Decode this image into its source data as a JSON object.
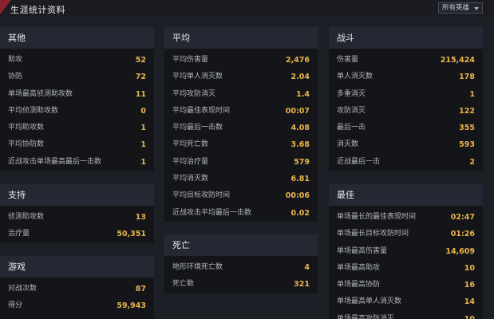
{
  "header": {
    "title": "生涯统计资料",
    "hero_filter": "所有英雄"
  },
  "panels": {
    "other": {
      "title": "其他",
      "rows": [
        {
          "label": "助攻",
          "value": "52"
        },
        {
          "label": "协防",
          "value": "72"
        },
        {
          "label": "单场最高侦测助攻数",
          "value": "11"
        },
        {
          "label": "平均侦测助攻数",
          "value": "0"
        },
        {
          "label": "平均助攻数",
          "value": "1"
        },
        {
          "label": "平均协防数",
          "value": "1"
        },
        {
          "label": "近战攻击单场最高最后一击数",
          "value": "1"
        }
      ]
    },
    "support": {
      "title": "支持",
      "rows": [
        {
          "label": "侦测助攻数",
          "value": "13"
        },
        {
          "label": "治疗量",
          "value": "50,351"
        }
      ]
    },
    "game": {
      "title": "游戏",
      "rows": [
        {
          "label": "对战次数",
          "value": "87"
        },
        {
          "label": "得分",
          "value": "59,943"
        }
      ]
    },
    "average": {
      "title": "平均",
      "rows": [
        {
          "label": "平均伤害量",
          "value": "2,476"
        },
        {
          "label": "平均单人消灭数",
          "value": "2.04"
        },
        {
          "label": "平均攻防消灭",
          "value": "1.4"
        },
        {
          "label": "平均最佳表现时间",
          "value": "00:07"
        },
        {
          "label": "平均最后一击数",
          "value": "4.08"
        },
        {
          "label": "平均死亡数",
          "value": "3.68"
        },
        {
          "label": "平均治疗量",
          "value": "579"
        },
        {
          "label": "平均消灭数",
          "value": "6.81"
        },
        {
          "label": "平均目标攻防时间",
          "value": "00:06"
        },
        {
          "label": "近战攻击平均最后一击数",
          "value": "0.02"
        }
      ]
    },
    "death": {
      "title": "死亡",
      "rows": [
        {
          "label": "地形环境死亡数",
          "value": "4"
        },
        {
          "label": "死亡数",
          "value": "321"
        }
      ]
    },
    "combat": {
      "title": "战斗",
      "rows": [
        {
          "label": "伤害量",
          "value": "215,424"
        },
        {
          "label": "单人消灭数",
          "value": "178"
        },
        {
          "label": "多重消灭",
          "value": "1"
        },
        {
          "label": "攻防消灭",
          "value": "122"
        },
        {
          "label": "最后一击",
          "value": "355"
        },
        {
          "label": "消灭数",
          "value": "593"
        },
        {
          "label": "近战最后一击",
          "value": "2"
        }
      ]
    },
    "best": {
      "title": "最佳",
      "rows": [
        {
          "label": "单场最长的最佳表现时间",
          "value": "02:47"
        },
        {
          "label": "单场最长目标攻防时间",
          "value": "01:26"
        },
        {
          "label": "单场最高伤害量",
          "value": "14,609"
        },
        {
          "label": "单场最高助攻",
          "value": "10"
        },
        {
          "label": "单场最高协防",
          "value": "16"
        },
        {
          "label": "单场最高单人消灭数",
          "value": "14"
        },
        {
          "label": "单场最高攻防消灭",
          "value": "10"
        }
      ]
    }
  }
}
